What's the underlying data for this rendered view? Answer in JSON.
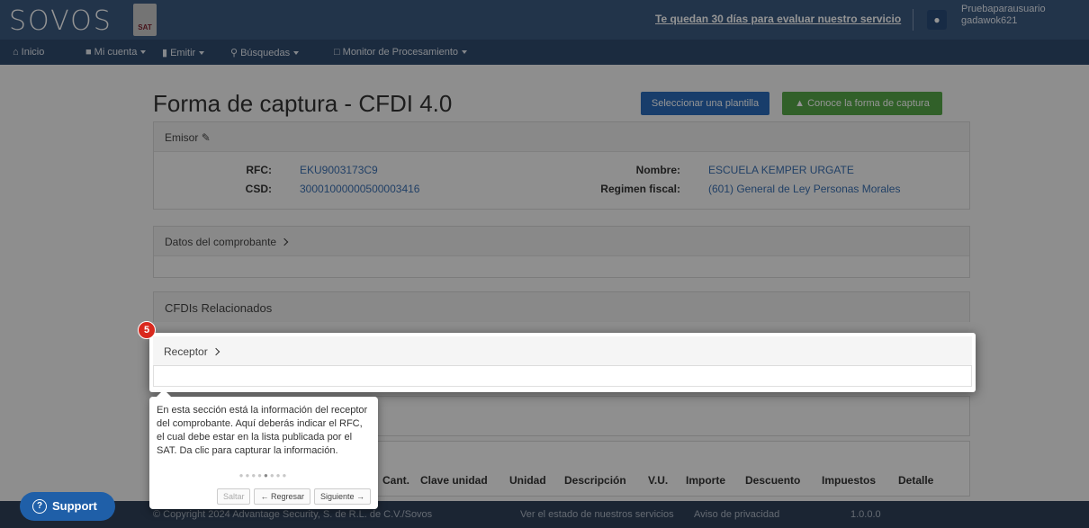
{
  "header": {
    "logo": "SOVOS",
    "sat_badge": "SAT",
    "trial_notice": "Te quedan 30 días para evaluar nuestro servicio",
    "user_line1": "Pruebaparausuario",
    "user_line2": "gadawok621"
  },
  "nav": {
    "inicio": "Inicio",
    "mi_cuenta": "Mi cuenta",
    "emitir": "Emitir",
    "busquedas": "Búsquedas",
    "monitor": "Monitor de Procesamiento"
  },
  "page": {
    "title": "Forma de captura - CFDI 4.0",
    "btn_plantilla": "Seleccionar una plantilla",
    "btn_conoce": "Conoce la forma de captura"
  },
  "emisor": {
    "heading": "Emisor",
    "rfc_label": "RFC:",
    "rfc": "EKU9003173C9",
    "csd_label": "CSD:",
    "csd": "30001000000500003416",
    "nombre_label": "Nombre:",
    "nombre": "ESCUELA KEMPER URGATE",
    "regimen_label": "Regimen fiscal:",
    "regimen": "(601) General de Ley Personas Morales"
  },
  "sections": {
    "datos": "Datos del comprobante",
    "cfdis": "CFDIs Relacionados",
    "receptor": "Receptor"
  },
  "table_headers": [
    "Cant.",
    "Clave unidad",
    "Unidad",
    "Descripción",
    "V.U.",
    "Importe",
    "Descuento",
    "Impuestos",
    "Detalle"
  ],
  "tour": {
    "step": "5",
    "text": "En esta sección está la información del receptor del comprobante. Aquí deberás indicar el RFC, el cual debe estar en la lista publicada por el SAT. Da clic para capturar la información.",
    "btn_skip": "Saltar",
    "btn_back": "← Regresar",
    "btn_next": "Siguiente →"
  },
  "footer": {
    "copyright": "© Copyright 2024 Advantage Security, S. de R.L. de C.V./Sovos",
    "status_link": "Ver el estado de nuestros servicios",
    "privacy": "Aviso de privacidad",
    "version": "1.0.0.0",
    "support": "Support"
  },
  "colors": {
    "header_bg": "#3c5a80",
    "btn_blue": "#2a6ab8",
    "btn_green": "#55a548",
    "badge_red": "#d9291e"
  }
}
